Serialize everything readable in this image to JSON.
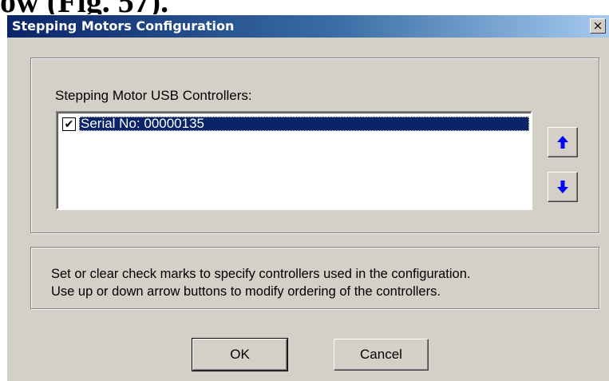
{
  "doc_fragment": "ow (Fig. 57).",
  "window": {
    "title": "Stepping Motors Configuration",
    "close_glyph": "×"
  },
  "controllers": {
    "label": "Stepping Motor USB Controllers:",
    "items": [
      {
        "label": "Serial No: 00000135",
        "checked": true,
        "checkmark": "✔"
      }
    ],
    "icons": {
      "up": "arrow-up-icon",
      "down": "arrow-down-icon"
    },
    "arrow_color": "#0000ff"
  },
  "help": {
    "line1": "Set or clear check marks to specify controllers used in the configuration.",
    "line2": "Use up or down arrow buttons to modify ordering of the controllers."
  },
  "buttons": {
    "ok": "OK",
    "cancel": "Cancel"
  },
  "colors": {
    "dialog_bg": "#d4d0c8",
    "selection": "#0a246a",
    "titlebar_start": "#0a246a",
    "titlebar_end": "#a6caf0"
  }
}
